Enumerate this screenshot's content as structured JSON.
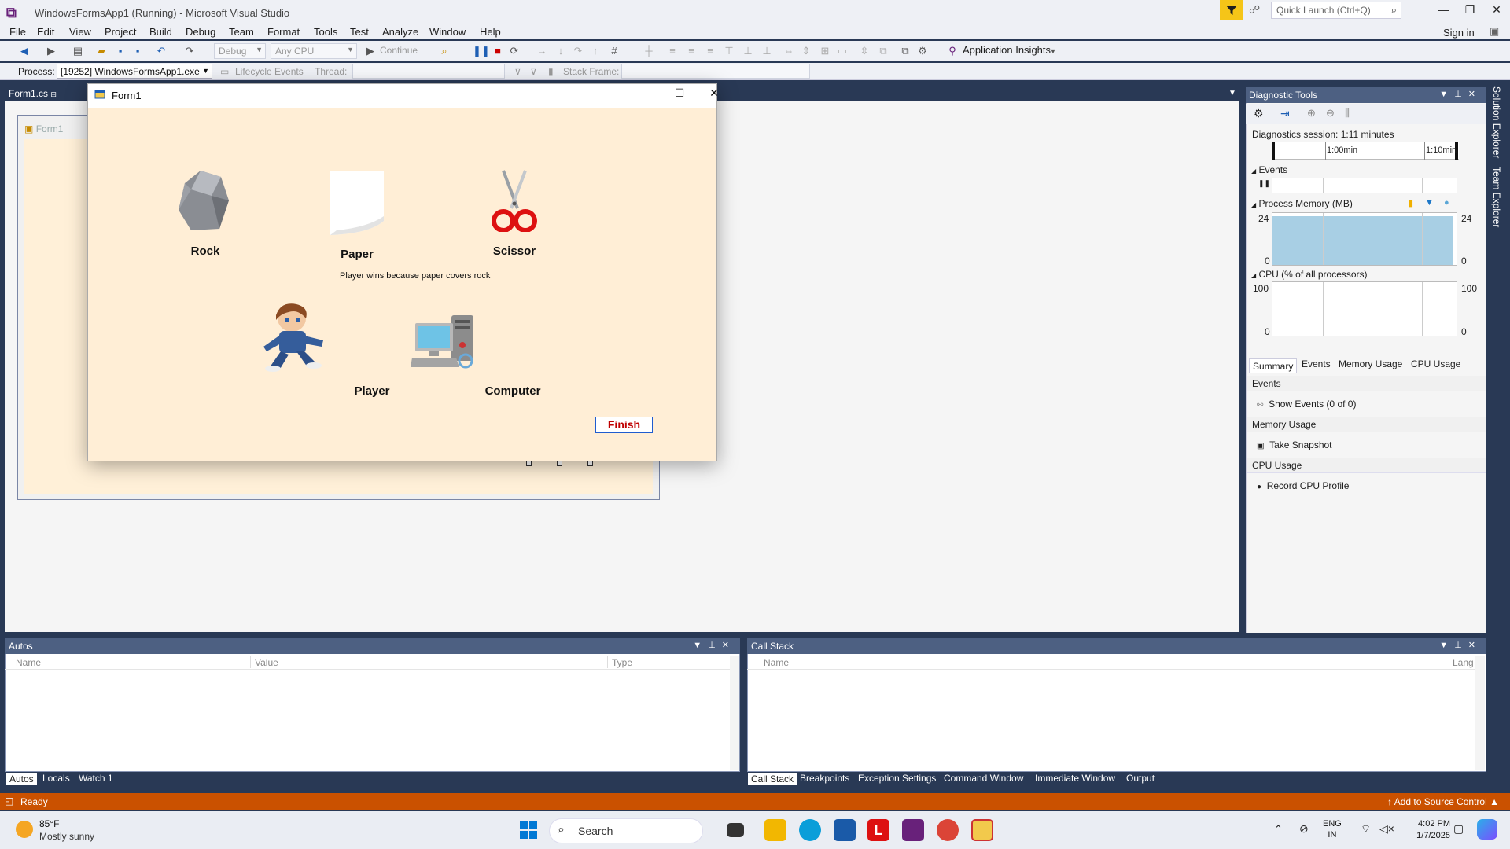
{
  "window": {
    "title": "WindowsFormsApp1 (Running) - Microsoft Visual Studio",
    "quick_launch_placeholder": "Quick Launch (Ctrl+Q)",
    "sign_in": "Sign in"
  },
  "menu": [
    "File",
    "Edit",
    "View",
    "Project",
    "Build",
    "Debug",
    "Team",
    "Format",
    "Tools",
    "Test",
    "Analyze",
    "Window",
    "Help"
  ],
  "toolbar": {
    "config": "Debug",
    "platform": "Any CPU",
    "continue": "Continue",
    "app_insights": "Application Insights"
  },
  "debugbar": {
    "process_label": "Process:",
    "process_value": "[19252] WindowsFormsApp1.exe",
    "lifecycle": "Lifecycle Events",
    "thread_label": "Thread:",
    "stack_label": "Stack Frame:"
  },
  "document": {
    "tab": "Form1.cs",
    "designer_title": "Form1"
  },
  "form": {
    "title": "Form1",
    "choices": [
      "Rock",
      "Paper",
      "Scissor"
    ],
    "player_label": "Player",
    "computer_label": "Computer",
    "result": "Player wins because paper covers rock",
    "finish": "Finish"
  },
  "diagnostics": {
    "title": "Diagnostic Tools",
    "session": "Diagnostics session: 1:11 minutes",
    "tick1": "1:00min",
    "tick2": "1:10min",
    "events_label": "Events",
    "memory_label": "Process Memory (MB)",
    "memory_max": "24",
    "memory_min": "0",
    "cpu_label": "CPU (% of all processors)",
    "cpu_max": "100",
    "cpu_min": "0",
    "memory_fill_fraction": 0.98,
    "tabs": [
      "Summary",
      "Events",
      "Memory Usage",
      "CPU Usage"
    ],
    "groups": {
      "events": "Events",
      "show_events": "Show Events (0 of 0)",
      "memory": "Memory Usage",
      "take_snapshot": "Take Snapshot",
      "cpu": "CPU Usage",
      "record_cpu": "Record CPU Profile"
    }
  },
  "side_tabs": [
    "Solution Explorer",
    "Team Explorer"
  ],
  "autos": {
    "title": "Autos",
    "cols": [
      "Name",
      "Value",
      "Type"
    ],
    "tabs": [
      "Autos",
      "Locals",
      "Watch 1"
    ]
  },
  "callstack": {
    "title": "Call Stack",
    "cols": [
      "Name",
      "Lang"
    ],
    "tabs": [
      "Call Stack",
      "Breakpoints",
      "Exception Settings",
      "Command Window",
      "Immediate Window",
      "Output"
    ]
  },
  "status": {
    "ready": "Ready",
    "source_control": "Add to Source Control"
  },
  "taskbar": {
    "temp": "85°F",
    "weather": "Mostly sunny",
    "search": "Search",
    "lang1": "ENG",
    "lang2": "IN",
    "time": "4:02 PM",
    "date": "1/7/2025"
  }
}
